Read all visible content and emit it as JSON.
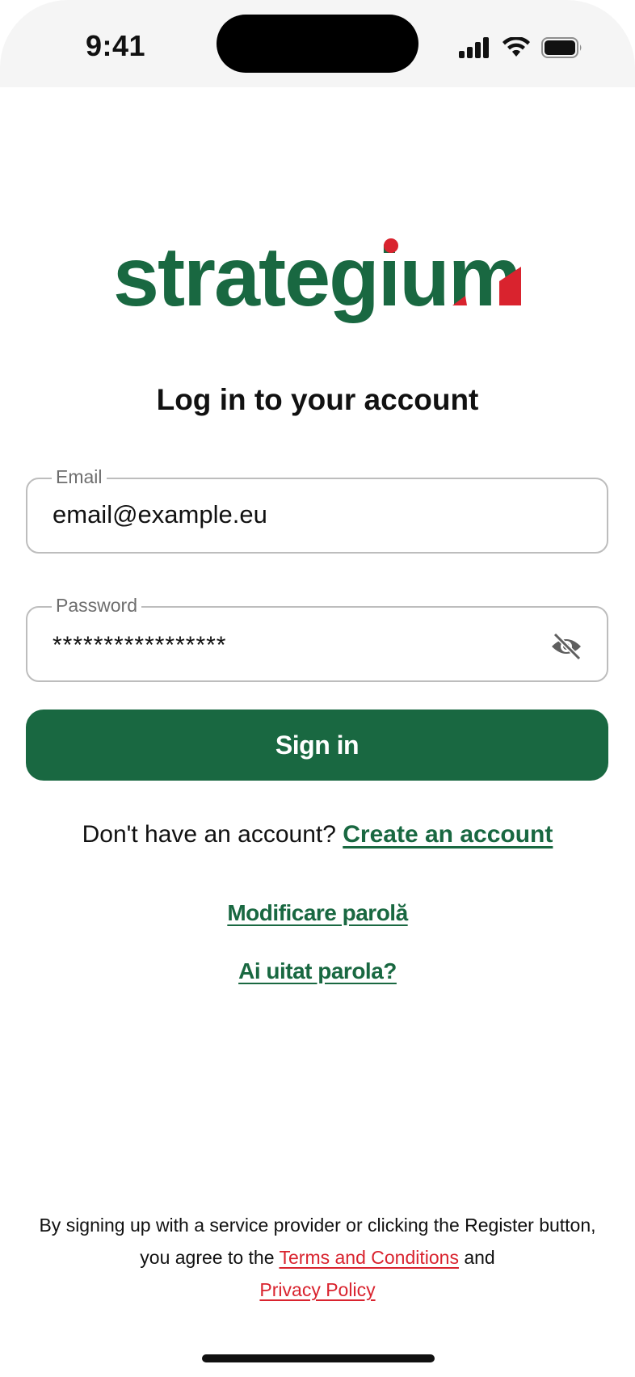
{
  "status_bar": {
    "time": "9:41"
  },
  "brand": {
    "logo_text": "strategium",
    "green": "#196841",
    "red": "#d9232e"
  },
  "page": {
    "heading": "Log in to your account"
  },
  "email": {
    "label": "Email",
    "value": "email@example.eu"
  },
  "password": {
    "label": "Password",
    "value": "*****************",
    "toggle_icon": "eye-off-icon"
  },
  "signin": {
    "label": "Sign in"
  },
  "signup": {
    "prompt": "Don't have an account?",
    "link": "Create an account"
  },
  "links": {
    "change_password": "Modificare parolă",
    "forgot_password": "Ai uitat parola?"
  },
  "legal": {
    "text_before": "By signing up with a service provider or clicking the Register button, you agree to the",
    "terms": "Terms and Conditions",
    "and": "and",
    "privacy": "Privacy Policy"
  }
}
